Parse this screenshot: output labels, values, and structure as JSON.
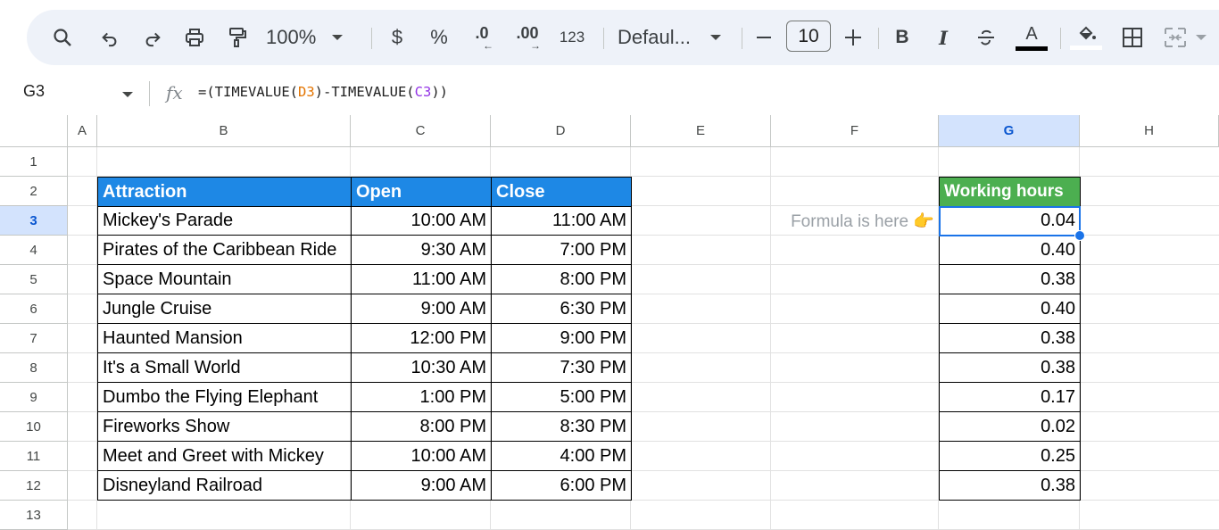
{
  "toolbar": {
    "zoom": "100%",
    "currency": "$",
    "percent": "%",
    "decrease_decimal": ".0",
    "increase_decimal": ".00",
    "more_formats": "123",
    "font_name": "Defaul...",
    "font_size": "10",
    "bold": "B",
    "italic": "I",
    "text_color_letter": "A",
    "icons": [
      "search-icon",
      "undo-icon",
      "redo-icon",
      "print-icon",
      "paint-format-icon",
      "strikethrough-icon",
      "fill-color-icon",
      "borders-icon",
      "merge-cells-icon"
    ]
  },
  "formula_bar": {
    "name_box": "G3",
    "fx": "fx",
    "formula_parts": [
      "=(TIMEVALUE(",
      "D3",
      ")-TIMEVALUE(",
      "C3",
      "))"
    ]
  },
  "grid": {
    "columns": [
      "A",
      "B",
      "C",
      "D",
      "E",
      "F",
      "G",
      "H"
    ],
    "rows": [
      "1",
      "2",
      "3",
      "4",
      "5",
      "6",
      "7",
      "8",
      "9",
      "10",
      "11",
      "12",
      "13"
    ],
    "selected_cell": "G3"
  },
  "table": {
    "headers": [
      "Attraction",
      "Open",
      "Close"
    ],
    "rows": [
      [
        "Mickey's Parade",
        "10:00 AM",
        "11:00 AM"
      ],
      [
        "Pirates of the Caribbean Ride",
        "9:30 AM",
        "7:00 PM"
      ],
      [
        "Space Mountain",
        "11:00 AM",
        "8:00 PM"
      ],
      [
        "Jungle Cruise",
        "9:00 AM",
        "6:30 PM"
      ],
      [
        "Haunted Mansion",
        "12:00 PM",
        "9:00 PM"
      ],
      [
        "It's a Small World",
        "10:30 AM",
        "7:30 PM"
      ],
      [
        "Dumbo the Flying Elephant",
        "1:00 PM",
        "5:00 PM"
      ],
      [
        "Fireworks Show",
        "8:00 PM",
        "8:30 PM"
      ],
      [
        "Meet and Greet with Mickey",
        "10:00 AM",
        "4:00 PM"
      ],
      [
        "Disneyland Railroad",
        "9:00 AM",
        "6:00 PM"
      ]
    ]
  },
  "hours": {
    "header": "Working hours",
    "values": [
      "0.04",
      "0.40",
      "0.38",
      "0.40",
      "0.38",
      "0.38",
      "0.17",
      "0.02",
      "0.25",
      "0.38"
    ]
  },
  "note": {
    "text": "Formula is here 👉"
  },
  "colors": {
    "table_header": "#1e88e5",
    "hours_header": "#4caf50",
    "selection": "#1a73e8",
    "ref_d": "#e37400",
    "ref_c": "#9334e6"
  }
}
